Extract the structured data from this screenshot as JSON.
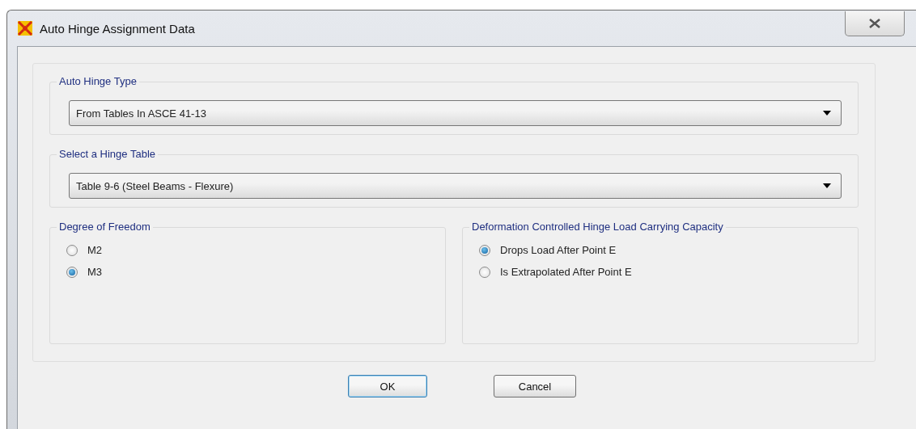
{
  "window": {
    "title": "Auto Hinge Assignment Data"
  },
  "auto_hinge_type": {
    "label": "Auto Hinge Type",
    "value": "From Tables In ASCE 41-13"
  },
  "hinge_table": {
    "label": "Select a Hinge Table",
    "value": "Table 9-6 (Steel Beams - Flexure)"
  },
  "degree_of_freedom": {
    "label": "Degree of Freedom",
    "options": [
      {
        "label": "M2",
        "selected": false
      },
      {
        "label": "M3",
        "selected": true
      }
    ]
  },
  "load_capacity": {
    "label": "Deformation Controlled Hinge Load Carrying Capacity",
    "options": [
      {
        "label": "Drops Load After Point E",
        "selected": true
      },
      {
        "label": "Is Extrapolated After Point E",
        "selected": false
      }
    ]
  },
  "buttons": [
    {
      "label": "OK",
      "default": true
    },
    {
      "label": "Cancel",
      "default": false
    }
  ]
}
